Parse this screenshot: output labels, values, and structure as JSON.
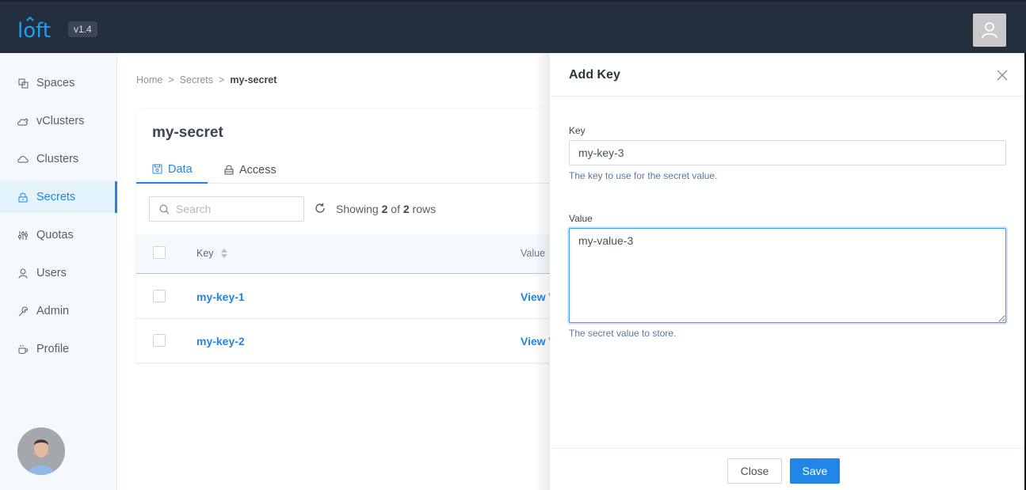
{
  "app": {
    "logo_text": "loft",
    "version": "v1.4",
    "brand_color": "#1f9ef0"
  },
  "sidebar": {
    "items": [
      {
        "label": "Spaces",
        "icon": "spaces-icon",
        "active": false
      },
      {
        "label": "vClusters",
        "icon": "vclusters-icon",
        "active": false
      },
      {
        "label": "Clusters",
        "icon": "cloud-icon",
        "active": false
      },
      {
        "label": "Secrets",
        "icon": "lock-icon",
        "active": true
      },
      {
        "label": "Quotas",
        "icon": "sliders-icon",
        "active": false
      },
      {
        "label": "Users",
        "icon": "user-icon",
        "active": false
      },
      {
        "label": "Admin",
        "icon": "wrench-icon",
        "active": false
      },
      {
        "label": "Profile",
        "icon": "coffee-icon",
        "active": false
      }
    ]
  },
  "breadcrumb": {
    "items": [
      "Home",
      "Secrets",
      "my-secret"
    ],
    "separator": ">"
  },
  "card": {
    "title": "my-secret",
    "tabs": [
      {
        "label": "Data",
        "icon": "save-icon",
        "active": true
      },
      {
        "label": "Access",
        "icon": "lock-icon",
        "active": false
      }
    ],
    "search_placeholder": "Search",
    "row_count": {
      "prefix": "Showing",
      "shown": "2",
      "of": "of",
      "total": "2",
      "suffix": "rows"
    },
    "table": {
      "columns": [
        "Key",
        "Value"
      ],
      "rows": [
        {
          "key": "my-key-1",
          "value": "View Value"
        },
        {
          "key": "my-key-2",
          "value": "View Value"
        }
      ]
    }
  },
  "drawer": {
    "title": "Add Key",
    "key_label": "Key",
    "key_value": "my-key-3",
    "key_hint": "The key to use for the secret value.",
    "value_label": "Value",
    "value_value": "my-value-3",
    "value_hint": "The secret value to store.",
    "close_label": "Close",
    "save_label": "Save"
  }
}
